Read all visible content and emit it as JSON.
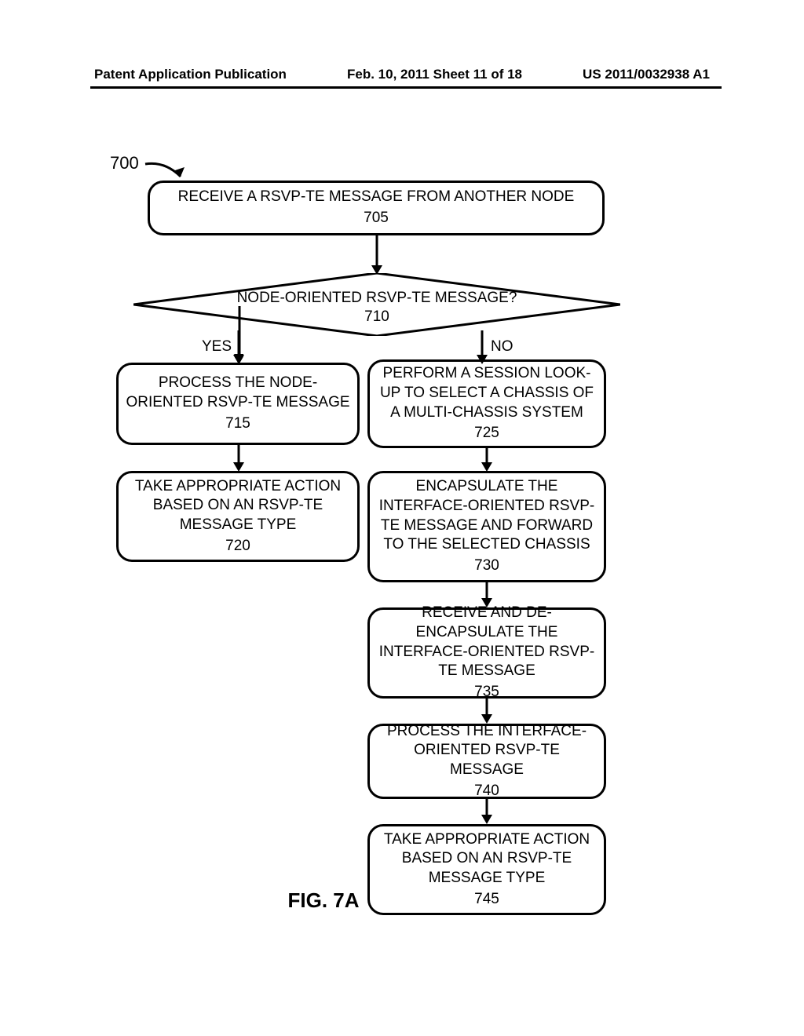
{
  "header": {
    "left": "Patent Application Publication",
    "center": "Feb. 10, 2011   Sheet 11 of 18",
    "right": "US 2011/0032938 A1"
  },
  "diagram_ref": "700",
  "boxes": {
    "705": {
      "text": "RECEIVE A RSVP-TE MESSAGE FROM ANOTHER NODE",
      "ref": "705"
    },
    "710": {
      "text": "NODE-ORIENTED RSVP-TE MESSAGE?",
      "ref": "710"
    },
    "715": {
      "text": "PROCESS THE NODE-ORIENTED RSVP-TE MESSAGE",
      "ref": "715"
    },
    "720": {
      "text": "TAKE APPROPRIATE ACTION BASED ON AN RSVP-TE MESSAGE TYPE",
      "ref": "720"
    },
    "725": {
      "text": "PERFORM A SESSION LOOK-UP TO SELECT A CHASSIS OF A MULTI-CHASSIS SYSTEM",
      "ref": "725"
    },
    "730": {
      "text": "ENCAPSULATE THE INTERFACE-ORIENTED RSVP-TE MESSAGE AND FORWARD TO THE SELECTED CHASSIS",
      "ref": "730"
    },
    "735": {
      "text": "RECEIVE AND DE-ENCAPSULATE THE INTERFACE-ORIENTED RSVP-TE MESSAGE",
      "ref": "735"
    },
    "740": {
      "text": "PROCESS THE INTERFACE-ORIENTED RSVP-TE MESSAGE",
      "ref": "740"
    },
    "745": {
      "text": "TAKE APPROPRIATE ACTION BASED ON AN RSVP-TE MESSAGE TYPE",
      "ref": "745"
    }
  },
  "decision_labels": {
    "yes": "YES",
    "no": "NO"
  },
  "figure_label": "FIG. 7A"
}
